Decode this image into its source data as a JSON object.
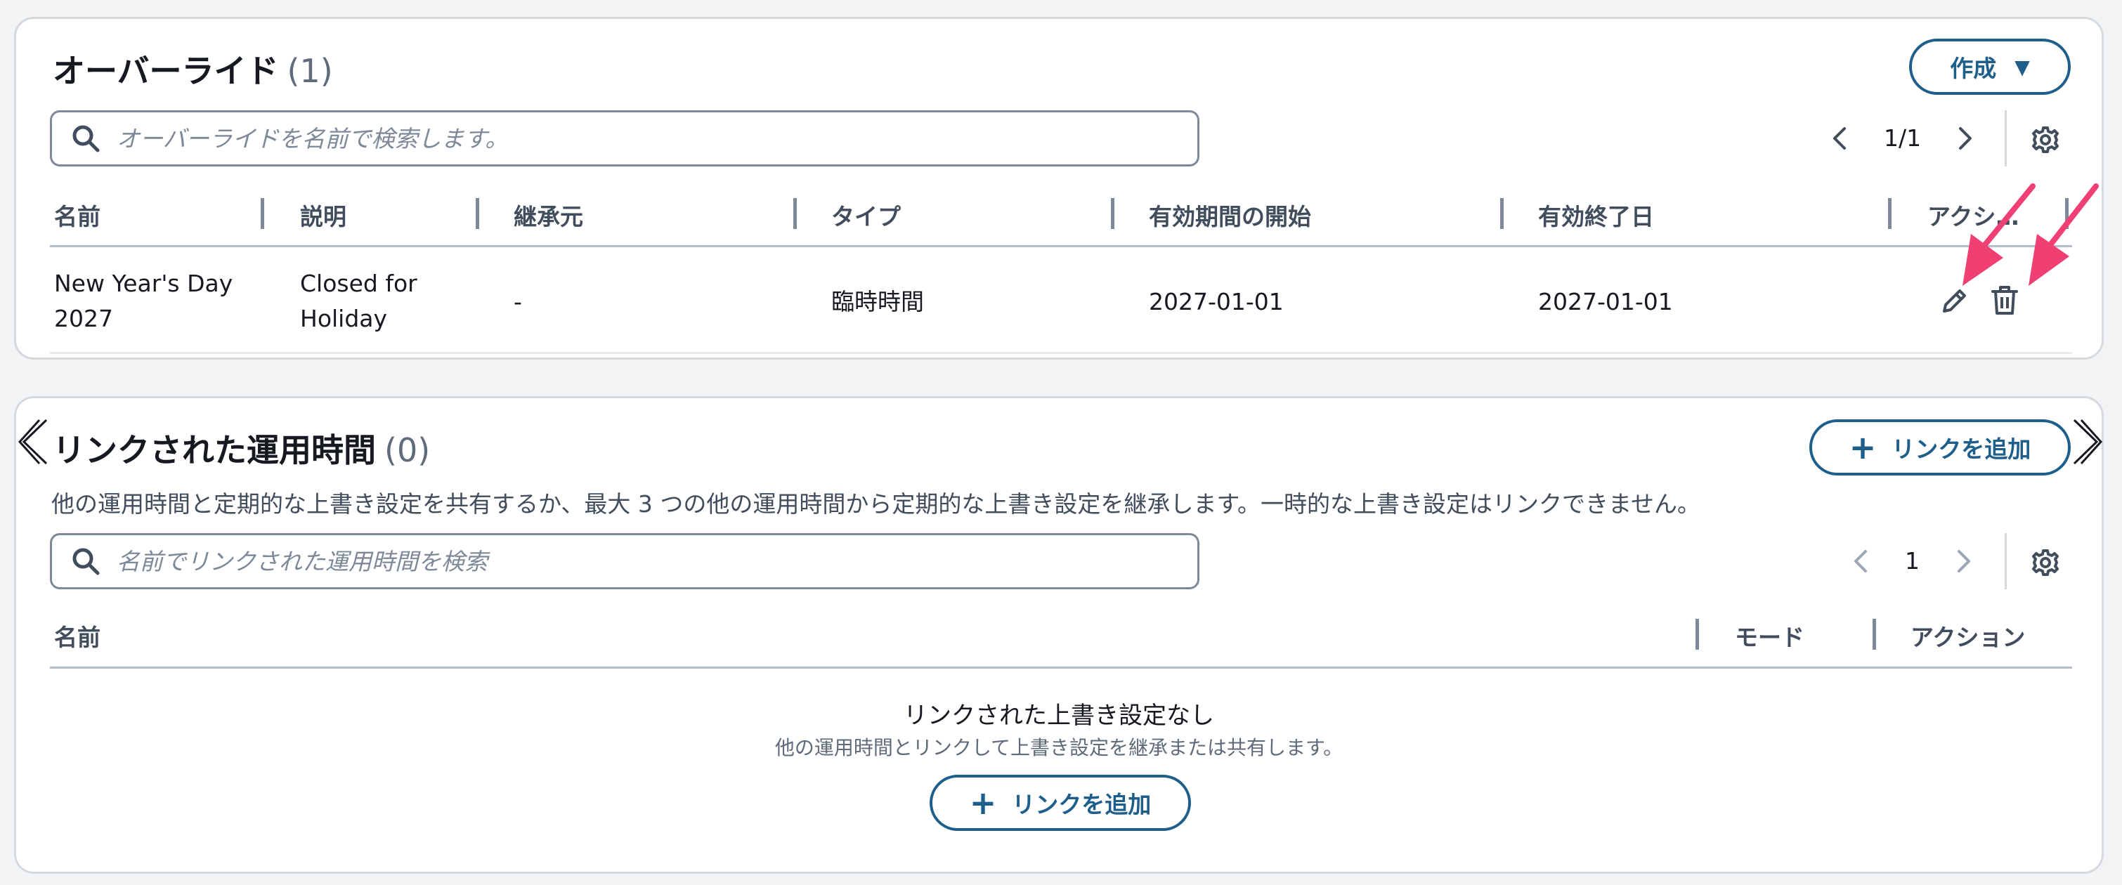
{
  "overrides": {
    "title": "オーバーライド",
    "count": "(1)",
    "create_button": "作成",
    "search_placeholder": "オーバーライドを名前で検索します。",
    "pagination": "1/1",
    "columns": [
      "名前",
      "説明",
      "継承元",
      "タイプ",
      "有効期間の開始",
      "有効終了日",
      "アクシ…"
    ],
    "rows": [
      {
        "name_line1": "New Year's Day",
        "name_line2": "2027",
        "description_line1": "Closed for",
        "description_line2": "Holiday",
        "inherited_from": "-",
        "type": "臨時時間",
        "start": "2027-01-01",
        "end": "2027-01-01"
      }
    ]
  },
  "linked": {
    "title": "リンクされた運用時間",
    "count": "(0)",
    "add_link_button": "リンクを追加",
    "description": "他の運用時間と定期的な上書き設定を共有するか、最大 3 つの他の運用時間から定期的な上書き設定を継承します。一時的な上書き設定はリンクできません。",
    "search_placeholder": "名前でリンクされた運用時間を検索",
    "pagination": "1",
    "columns": [
      "名前",
      "モード",
      "アクション"
    ],
    "empty_title": "リンクされた上書き設定なし",
    "empty_subtitle": "他の運用時間とリンクして上書き設定を継承または共有します。",
    "empty_add_button": "リンクを追加"
  },
  "colors": {
    "primary": "#1d5f8a",
    "annotation_arrow": "#ef3f73",
    "border": "#d5d9dd",
    "text": "#16191f"
  },
  "icons": [
    "search-icon",
    "chevron-left-icon",
    "chevron-right-icon",
    "gear-icon",
    "caret-down-icon",
    "plus-icon",
    "pencil-icon",
    "trash-icon",
    "double-chevron-left-icon",
    "double-chevron-right-icon",
    "annotation-arrow-icon"
  ]
}
